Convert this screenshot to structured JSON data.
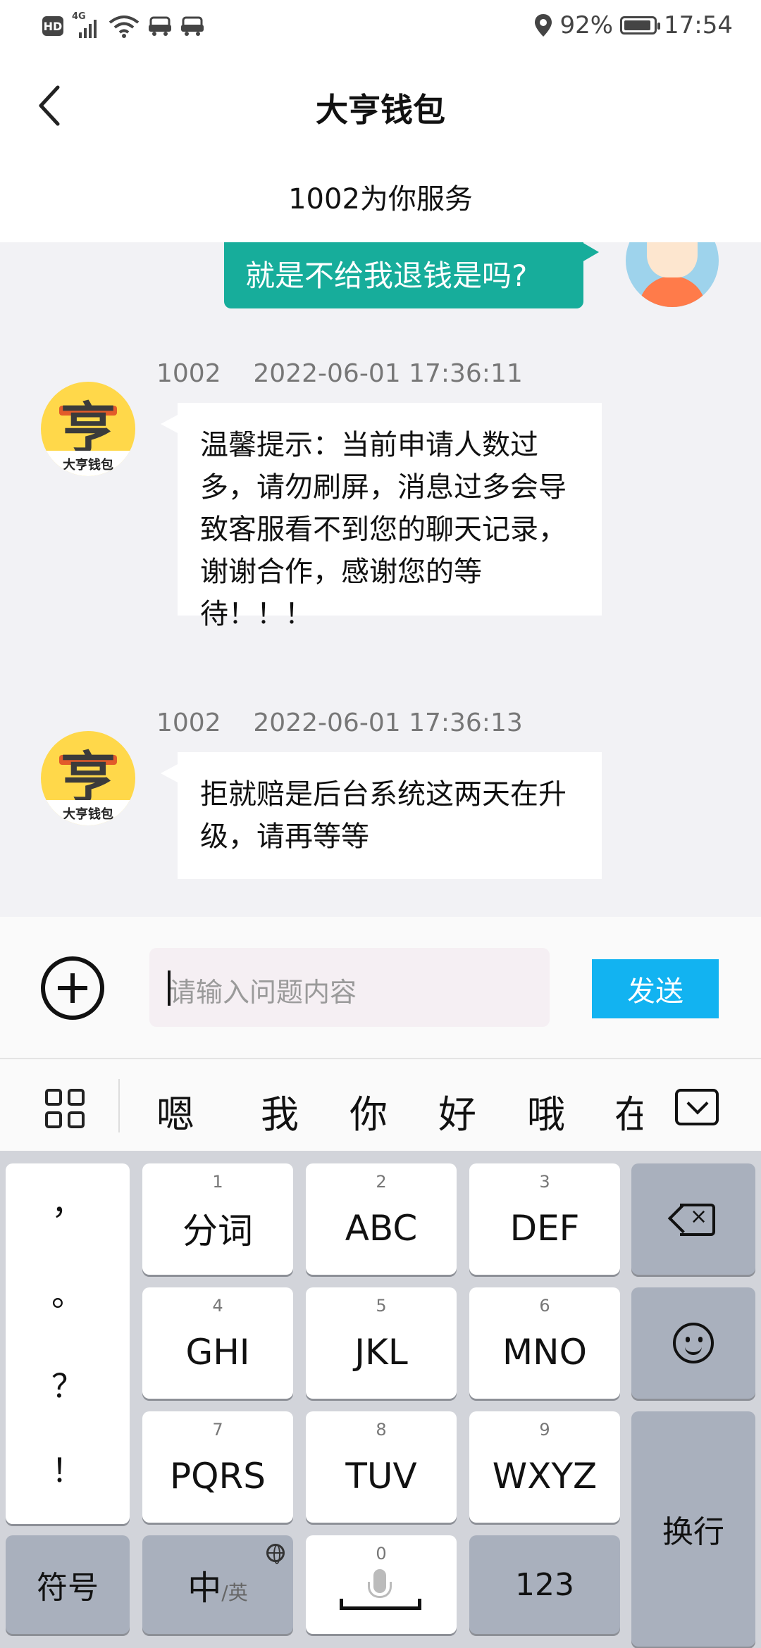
{
  "status": {
    "hd": "HD",
    "network": "4G",
    "battery_text": "92%",
    "battery_level": 0.92,
    "time": "17:54"
  },
  "header": {
    "title": "大亨钱包",
    "subtitle": "1002为你服务"
  },
  "chat": {
    "outgoing": {
      "text": "就是不给我退钱是吗?"
    },
    "messages": [
      {
        "sender": "1002",
        "timestamp": "2022-06-01 17:36:11",
        "avatar_label": "大亨钱包",
        "avatar_glyph": "亨",
        "text": "温馨提示：当前申请人数过多，请勿刷屏，消息过多会导致客服看不到您的聊天记录，谢谢合作，感谢您的等待！！！"
      },
      {
        "sender": "1002",
        "timestamp": "2022-06-01 17:36:13",
        "avatar_label": "大亨钱包",
        "avatar_glyph": "亨",
        "text": "拒就赔是后台系统这两天在升级，请再等等"
      }
    ]
  },
  "input": {
    "placeholder": "请输入问题内容",
    "send_label": "发送"
  },
  "candidates": [
    "嗯",
    "我",
    "你",
    "好",
    "哦",
    "在"
  ],
  "keyboard": {
    "punctuation": [
      "，",
      "。",
      "？",
      "！"
    ],
    "keys": [
      {
        "num": "1",
        "label": "分词"
      },
      {
        "num": "2",
        "label": "ABC"
      },
      {
        "num": "3",
        "label": "DEF"
      },
      {
        "num": "4",
        "label": "GHI"
      },
      {
        "num": "5",
        "label": "JKL"
      },
      {
        "num": "6",
        "label": "MNO"
      },
      {
        "num": "7",
        "label": "PQRS"
      },
      {
        "num": "8",
        "label": "TUV"
      },
      {
        "num": "9",
        "label": "WXYZ"
      }
    ],
    "enter_label": "换行",
    "symbols_label": "符号",
    "lang_main": "中",
    "lang_sub": "/英",
    "space_num": "0",
    "numbers_label": "123"
  },
  "colors": {
    "outgoing_bubble": "#17ad9b",
    "send_button": "#12b3f1",
    "chat_background": "#f2f2f5",
    "keyboard_background": "#d2d4da"
  }
}
